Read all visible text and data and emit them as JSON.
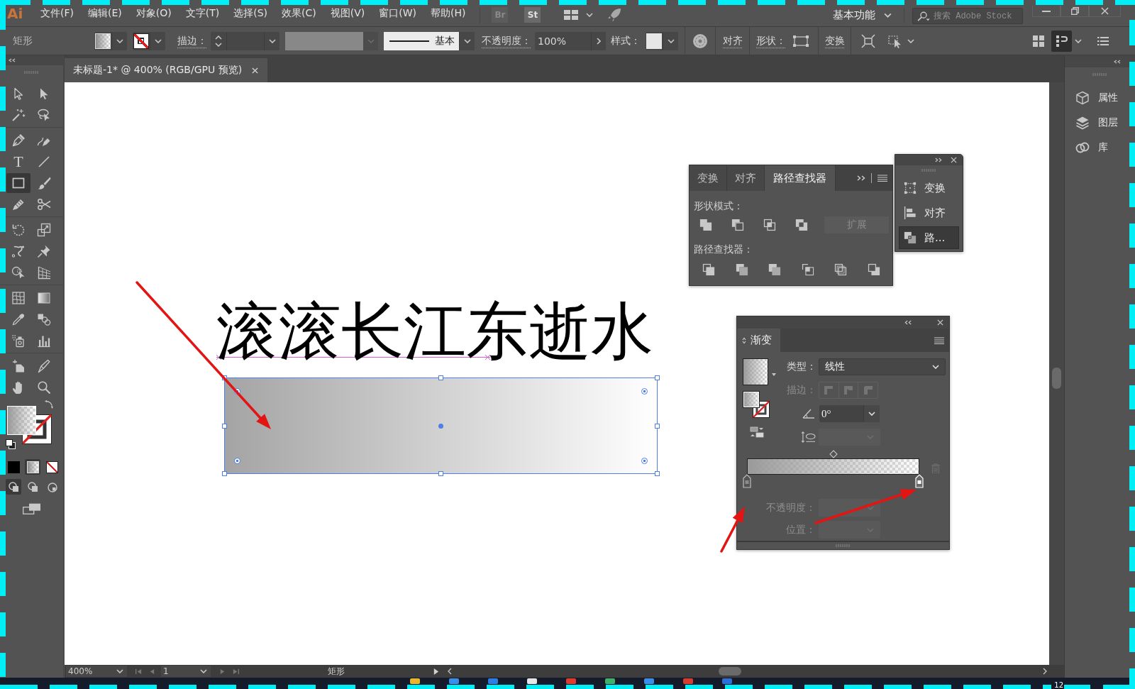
{
  "app": {
    "logo": "Ai"
  },
  "menu_bar": {
    "items": [
      "文件(F)",
      "编辑(E)",
      "对象(O)",
      "文字(T)",
      "选择(S)",
      "效果(C)",
      "视图(V)",
      "窗口(W)",
      "帮助(H)"
    ],
    "bridge": "Br",
    "stock": "St",
    "workspace": "基本功能",
    "search": {
      "placeholder": "搜索 Adobe Stock"
    }
  },
  "control_bar": {
    "object_type": "矩形",
    "stroke_label": "描边：",
    "stroke_style": "基本",
    "opacity_label": "不透明度：",
    "opacity": "100%",
    "style_label": "样式：",
    "align": "对齐",
    "shape_label": "形状：",
    "transform": "变换"
  },
  "document_tab": {
    "title": "未标题-1* @ 400% (RGB/GPU 预览)"
  },
  "tool_groups": [
    [
      {
        "kind": "select",
        "selected": false
      },
      {
        "kind": "direct",
        "selected": false
      },
      {
        "kind": "wand",
        "selected": false
      },
      {
        "kind": "lasso",
        "selected": false
      }
    ],
    [
      {
        "kind": "pen",
        "selected": false
      },
      {
        "kind": "curvature",
        "selected": false
      },
      {
        "kind": "type",
        "glyph": "T",
        "selected": false
      },
      {
        "kind": "line",
        "selected": false
      },
      {
        "kind": "rectangle",
        "selected": true
      },
      {
        "kind": "brush",
        "selected": false
      },
      {
        "kind": "shaper",
        "selected": false
      },
      {
        "kind": "scissors",
        "selected": false
      }
    ],
    [
      {
        "kind": "rotate",
        "selected": false
      },
      {
        "kind": "scale",
        "selected": false
      },
      {
        "kind": "warp",
        "selected": false
      },
      {
        "kind": "pin",
        "selected": false
      },
      {
        "kind": "builder",
        "selected": false
      },
      {
        "kind": "perspective",
        "selected": false
      }
    ],
    [
      {
        "kind": "mesh",
        "selected": false
      },
      {
        "kind": "gradient",
        "selected": false
      },
      {
        "kind": "eyedropper",
        "selected": false
      },
      {
        "kind": "blend",
        "selected": false
      },
      {
        "kind": "sprayer",
        "selected": false
      },
      {
        "kind": "graph",
        "selected": false
      }
    ],
    [
      {
        "kind": "artboard",
        "selected": false
      },
      {
        "kind": "knife",
        "selected": false
      },
      {
        "kind": "hand",
        "selected": false
      },
      {
        "kind": "zoom",
        "selected": false
      }
    ]
  ],
  "color_modes": [
    {
      "kind": "color",
      "selected": false
    },
    {
      "kind": "gradient",
      "selected": true
    },
    {
      "kind": "none",
      "selected": false
    }
  ],
  "draw_modes": [
    {
      "kind": "normal",
      "selected": true
    },
    {
      "kind": "behind",
      "selected": false
    },
    {
      "kind": "inside",
      "selected": false
    }
  ],
  "canvas": {
    "headline": "滚滚长江东逝水",
    "rectangle": {
      "selected": true
    }
  },
  "pathfinder_panel": {
    "tabs": [
      {
        "label": "变换",
        "selected": false
      },
      {
        "label": "对齐",
        "selected": false
      },
      {
        "label": "路径查找器",
        "selected": true
      }
    ],
    "shape_modes_label": "形状模式：",
    "expand_button": {
      "label": "扩展",
      "disabled": true
    },
    "pathfinders_label": "路径查找器："
  },
  "collapsed_dock": {
    "items": [
      {
        "kind": "transform",
        "label": "变换",
        "selected": false
      },
      {
        "kind": "align",
        "label": "对齐",
        "selected": false
      },
      {
        "kind": "pathfinder",
        "label": "路...",
        "selected": true
      }
    ]
  },
  "gradient_panel": {
    "title": "渐变",
    "type": {
      "label": "类型：",
      "value": "线性"
    },
    "stroke": {
      "label": "描边：",
      "disabled": true
    },
    "angle": {
      "value": "0°"
    },
    "aspect_ratio": {
      "disabled": true
    },
    "midpoint": {
      "level": 0.5
    },
    "stops": [
      {
        "level": 0,
        "selected": false
      },
      {
        "level": 1,
        "selected": true
      }
    ],
    "opacity": {
      "label": "不透明度：",
      "disabled": true
    },
    "location": {
      "label": "位置：",
      "disabled": true
    }
  },
  "right_dock": {
    "items": [
      {
        "kind": "properties",
        "label": "属性"
      },
      {
        "kind": "layers",
        "label": "图层"
      },
      {
        "kind": "libraries",
        "label": "库"
      }
    ]
  },
  "status_bar": {
    "zoom": "400%",
    "page": "1",
    "tool": "矩形"
  },
  "taskbar": {
    "clock": "12"
  }
}
